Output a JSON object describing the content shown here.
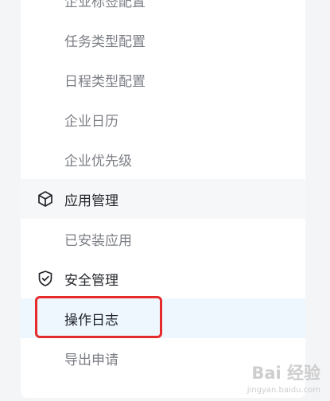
{
  "menu": {
    "top_cut_item": "企业标签配置",
    "enterprise_items": [
      "任务类型配置",
      "日程类型配置",
      "企业日历",
      "企业优先级"
    ],
    "app_group": {
      "label": "应用管理",
      "icon": "cube-icon"
    },
    "app_items": [
      "已安装应用"
    ],
    "security_group": {
      "label": "安全管理",
      "icon": "shield-check-icon"
    },
    "security_items": [
      "操作日志",
      "导出申请"
    ],
    "active_item": "操作日志"
  },
  "colors": {
    "highlight_border": "#e62b2b",
    "active_bg": "#eef7fe"
  },
  "watermark": {
    "logo": "Bai 经验",
    "site": "jingyan.baidu.com"
  }
}
